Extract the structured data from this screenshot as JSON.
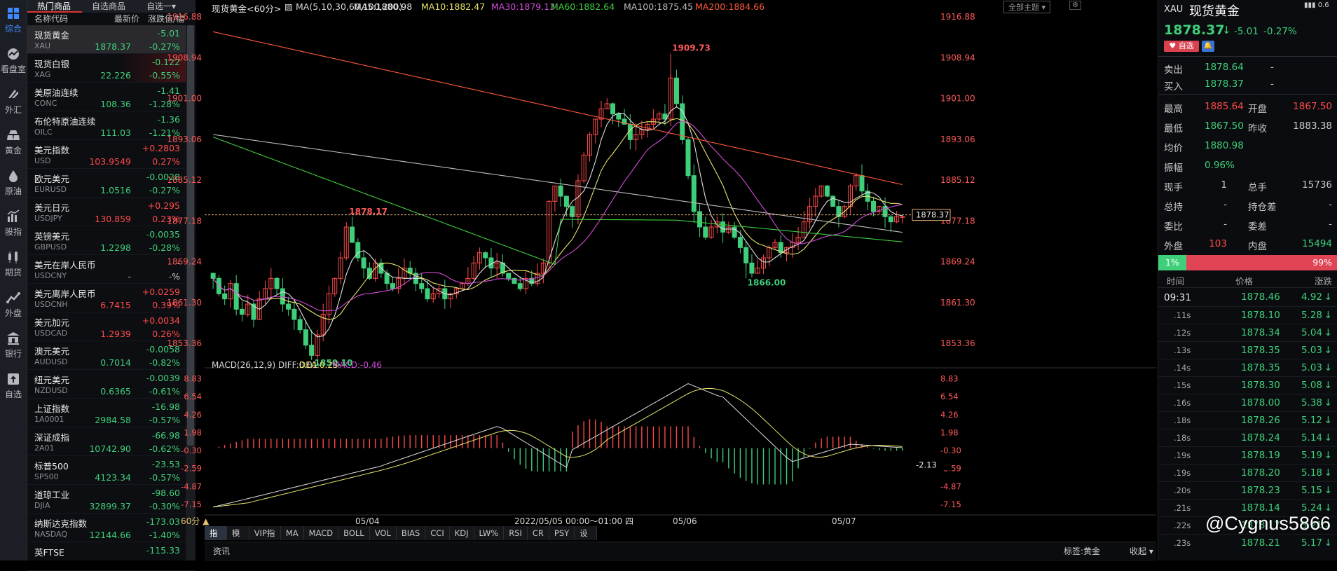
{
  "nav": [
    {
      "label": "综合",
      "icon": "grid-icon"
    },
    {
      "label": "看盘室",
      "icon": "chart-line-icon"
    },
    {
      "label": "外汇",
      "icon": "exchange-icon"
    },
    {
      "label": "黄金",
      "icon": "gold-bars-icon"
    },
    {
      "label": "原油",
      "icon": "oil-drop-icon"
    },
    {
      "label": "股指",
      "icon": "stock-bars-icon"
    },
    {
      "label": "期货",
      "icon": "candles-icon"
    },
    {
      "label": "外盘",
      "icon": "trend-icon"
    },
    {
      "label": "银行",
      "icon": "bank-icon"
    },
    {
      "label": "自选",
      "icon": "upload-icon"
    }
  ],
  "watchlist": {
    "tabs": [
      "热门商品",
      "自选商品",
      "自选一"
    ],
    "tab_arrow": "▾",
    "headers": {
      "name": "名称代码",
      "price": "最新价",
      "change": "涨跌值/幅"
    },
    "rows": [
      {
        "name": "现货黄金",
        "code": "XAU",
        "change": "-5.01",
        "price": "1878.37",
        "pct": "-0.27%",
        "dir": "dn",
        "selected": true
      },
      {
        "name": "现货白银",
        "code": "XAG",
        "change": "-0.122",
        "price": "22.226",
        "pct": "-0.55%",
        "dir": "dn",
        "hl": true
      },
      {
        "name": "美原油连续",
        "code": "CONC",
        "change": "-1.41",
        "price": "108.36",
        "pct": "-1.28%",
        "dir": "dn"
      },
      {
        "name": "布伦特原油连续",
        "code": "OILC",
        "change": "-1.36",
        "price": "111.03",
        "pct": "-1.21%",
        "dir": "dn"
      },
      {
        "name": "美元指数",
        "code": "USD",
        "change": "+0.2803",
        "price": "103.9549",
        "pct": "0.27%",
        "dir": "up"
      },
      {
        "name": "欧元美元",
        "code": "EURUSD",
        "change": "-0.0028",
        "price": "1.0516",
        "pct": "-0.27%",
        "dir": "dn"
      },
      {
        "name": "美元日元",
        "code": "USDJPY",
        "change": "+0.295",
        "price": "130.859",
        "pct": "0.23%",
        "dir": "up"
      },
      {
        "name": "英镑美元",
        "code": "GBPUSD",
        "change": "-0.0035",
        "price": "1.2298",
        "pct": "-0.28%",
        "dir": "dn"
      },
      {
        "name": "美元在岸人民币",
        "code": "USDCNY",
        "change": "-",
        "price": "-",
        "pct": "-%",
        "dir": "wh"
      },
      {
        "name": "美元离岸人民币",
        "code": "USDCNH",
        "change": "+0.0259",
        "price": "6.7415",
        "pct": "0.39%",
        "dir": "up"
      },
      {
        "name": "美元加元",
        "code": "USDCAD",
        "change": "+0.0034",
        "price": "1.2939",
        "pct": "0.26%",
        "dir": "up"
      },
      {
        "name": "澳元美元",
        "code": "AUDUSD",
        "change": "-0.0058",
        "price": "0.7014",
        "pct": "-0.82%",
        "dir": "dn"
      },
      {
        "name": "纽元美元",
        "code": "NZDUSD",
        "change": "-0.0039",
        "price": "0.6365",
        "pct": "-0.61%",
        "dir": "dn"
      },
      {
        "name": "上证指数",
        "code": "1A0001",
        "change": "-16.98",
        "price": "2984.58",
        "pct": "-0.57%",
        "dir": "dn"
      },
      {
        "name": "深证成指",
        "code": "2A01",
        "change": "-66.98",
        "price": "10742.90",
        "pct": "-0.62%",
        "dir": "dn"
      },
      {
        "name": "标普500",
        "code": "SP500",
        "change": "-23.53",
        "price": "4123.34",
        "pct": "-0.57%",
        "dir": "dn"
      },
      {
        "name": "道琼工业",
        "code": "DJIA",
        "change": "-98.60",
        "price": "32899.37",
        "pct": "-0.30%",
        "dir": "dn"
      },
      {
        "name": "纳斯达克指数",
        "code": "NASDAQ",
        "change": "-173.03",
        "price": "12144.66",
        "pct": "-1.40%",
        "dir": "dn"
      },
      {
        "name": "英FTSE",
        "code": "",
        "change": "-115.33",
        "price": "",
        "pct": "",
        "dir": "dn"
      }
    ]
  },
  "chart": {
    "title": "现货黄金<60分>",
    "ma_labels": [
      {
        "text": "MA(5,10,30,60,100,200)",
        "color": "#d8d8d8"
      },
      {
        "text": "MA5:1880.98",
        "color": "#e0e0e0"
      },
      {
        "text": "MA10:1882.47",
        "color": "#e8e36a"
      },
      {
        "text": "MA30:1879.13",
        "color": "#d24bd8"
      },
      {
        "text": "MA60:1882.64",
        "color": "#3fcf3f"
      },
      {
        "text": "MA100:1875.45",
        "color": "#bdbdbd"
      },
      {
        "text": "MA200:1884.66",
        "color": "#ff5a3a"
      }
    ],
    "topic_select": "全部主题",
    "price_ticks": [
      "1916.88",
      "1908.94",
      "1901.00",
      "1893.06",
      "1885.12",
      "1877.18",
      "1869.24",
      "1861.30",
      "1853.36"
    ],
    "high_label": "1909.73",
    "low_label": "1850.10",
    "mid_high_label": "1878.17",
    "mid_low_label": "1866.00",
    "last_price_tag": "1878.37",
    "macd_title": "MACD(26,12,9)",
    "diff": "DIFF:0.01",
    "dea": "DEA:0.25",
    "macd": "MACD:-0.46",
    "macd_ticks": [
      "8.83",
      "6.54",
      "4.26",
      "1.98",
      "-0.30",
      "-2.59",
      "-4.87",
      "-7.15"
    ],
    "macd_tag": "-2.13",
    "period": "60分 ▲",
    "dates": [
      "05/04",
      "05/06",
      "05/07"
    ],
    "crosshair_time": "2022/05/05 00:00～01:00 四",
    "bottom_tabs": [
      "指标",
      "模板",
      "VIP指标",
      "MA",
      "MACD",
      "BOLL",
      "VOL",
      "BIAS",
      "CCI",
      "KDJ",
      "LW%",
      "RSI",
      "CR",
      "PSY",
      "设置"
    ],
    "info_tab": "资讯",
    "tag_label": "标签:黄金",
    "collapse_label": "收起"
  },
  "chart_data": {
    "type": "candlestick",
    "title": "现货黄金<60分>",
    "ylim": [
      1849,
      1918
    ],
    "high": 1909.73,
    "low": 1850.1,
    "last": 1878.37,
    "macd": {
      "diff": 0.01,
      "dea": 0.25,
      "macd": -0.46,
      "ylim": [
        -8.5,
        9.5
      ]
    }
  },
  "right": {
    "symbol": "XAU",
    "name": "现货黄金",
    "price": "1878.37",
    "arrow": "↓",
    "change": "-5.01",
    "pct": "-0.27%",
    "watch_btn": "自选",
    "speed": "0.6",
    "bid_ask": [
      {
        "label": "卖出",
        "value": "1878.64",
        "extra": "-"
      },
      {
        "label": "买入",
        "value": "1878.37",
        "extra": "-"
      }
    ],
    "stats": [
      [
        {
          "l": "最高",
          "v": "1885.64",
          "c": "up"
        },
        {
          "l": "开盘",
          "v": "1867.50",
          "c": "up"
        }
      ],
      [
        {
          "l": "最低",
          "v": "1867.50",
          "c": "dn"
        },
        {
          "l": "昨收",
          "v": "1883.38",
          "c": "wh"
        }
      ],
      [
        {
          "l": "均价",
          "v": "1880.98",
          "c": "dn"
        },
        {
          "l": "",
          "v": "",
          "c": "wh"
        }
      ],
      [
        {
          "l": "振幅",
          "v": "0.96%",
          "c": "dn"
        },
        {
          "l": "",
          "v": "",
          "c": "wh"
        }
      ],
      [
        {
          "l": "现手",
          "v": "1",
          "c": "wh"
        },
        {
          "l": "总手",
          "v": "15736",
          "c": "wh"
        }
      ],
      [
        {
          "l": "总持",
          "v": "-",
          "c": "wh"
        },
        {
          "l": "持仓差",
          "v": "-",
          "c": "wh"
        }
      ],
      [
        {
          "l": "委比",
          "v": "-",
          "c": "wh"
        },
        {
          "l": "委差",
          "v": "-",
          "c": "wh"
        }
      ],
      [
        {
          "l": "外盘",
          "v": "103",
          "c": "up"
        },
        {
          "l": "内盘",
          "v": "15494",
          "c": "dn"
        }
      ]
    ],
    "ratio_left": "1%",
    "ratio_right": "99%",
    "tick_headers": [
      "时间",
      "价格",
      "涨跌"
    ],
    "ticks": [
      {
        "t": "09:31",
        "p": "1878.46",
        "d": "4.92"
      },
      {
        "t": ".11s",
        "p": "1878.10",
        "d": "5.28"
      },
      {
        "t": ".12s",
        "p": "1878.34",
        "d": "5.04"
      },
      {
        "t": ".13s",
        "p": "1878.35",
        "d": "5.03"
      },
      {
        "t": ".14s",
        "p": "1878.35",
        "d": "5.03"
      },
      {
        "t": ".15s",
        "p": "1878.30",
        "d": "5.08"
      },
      {
        "t": ".16s",
        "p": "1878.00",
        "d": "5.38"
      },
      {
        "t": ".18s",
        "p": "1878.26",
        "d": "5.12"
      },
      {
        "t": ".18s",
        "p": "1878.24",
        "d": "5.14"
      },
      {
        "t": ".19s",
        "p": "1878.19",
        "d": "5.19"
      },
      {
        "t": ".19s",
        "p": "1878.20",
        "d": "5.18"
      },
      {
        "t": ".20s",
        "p": "1878.23",
        "d": "5.15"
      },
      {
        "t": ".21s",
        "p": "1878.14",
        "d": "5.24"
      },
      {
        "t": ".22s",
        "p": "1878.17",
        "d": "5.21"
      },
      {
        "t": ".23s",
        "p": "1878.21",
        "d": "5.17"
      }
    ],
    "tick_arrow": "↓",
    "watermark": "@Cygnus5866"
  }
}
